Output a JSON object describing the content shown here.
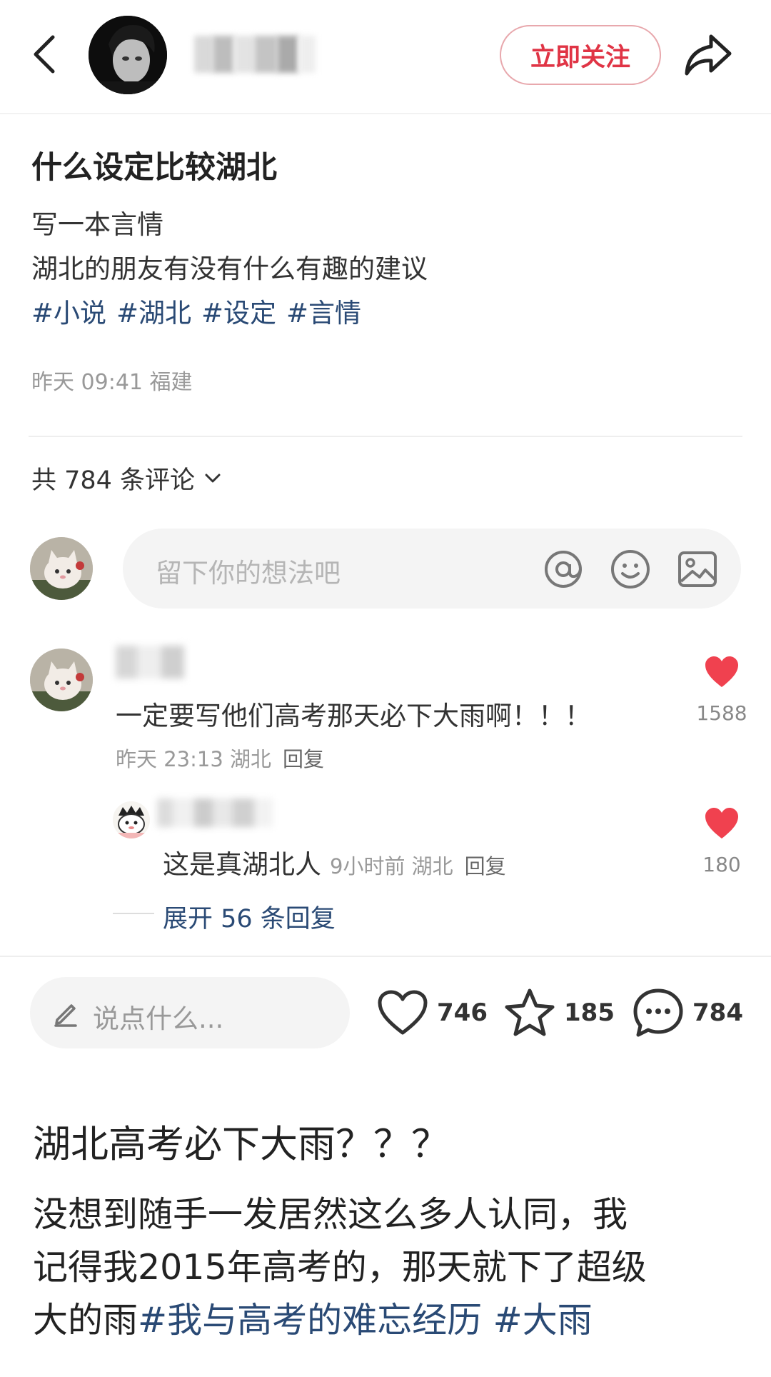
{
  "header": {
    "follow_label": "立即关注"
  },
  "post": {
    "title": "什么设定比较湖北",
    "lines": [
      "写一本言情",
      "湖北的朋友有没有什么有趣的建议"
    ],
    "tags": [
      "#小说",
      "#湖北",
      "#设定",
      "#言情"
    ],
    "meta": "昨天 09:41 福建"
  },
  "comments_header": {
    "label": "共 784 条评论"
  },
  "comment_input": {
    "placeholder": "留下你的想法吧",
    "icons": [
      "at-icon",
      "emoji-icon",
      "image-icon"
    ]
  },
  "comments": [
    {
      "text": "一定要写他们高考那天必下大雨啊！！！",
      "meta": "昨天 23:13 湖北",
      "reply_label": "回复",
      "likes": "1588"
    }
  ],
  "reply": {
    "text": "这是真湖北人",
    "meta": "9小时前 湖北",
    "reply_label": "回复",
    "likes": "180"
  },
  "expand": {
    "label": "展开 56 条回复"
  },
  "bottom_bar": {
    "placeholder": "说点什么...",
    "likes": "746",
    "stars": "185",
    "comments": "784"
  },
  "caption": {
    "title": "湖北高考必下大雨？？？",
    "line1": "没想到随手一发居然这么多人认同，我",
    "line2": "记得我2015年高考的，那天就下了超级",
    "line3_text": "大的雨",
    "line3_tags": "#我与高考的难忘经历 #大雨"
  },
  "colors": {
    "accent": "#e03445",
    "link": "#2a4a75",
    "heart": "#f0414f"
  }
}
